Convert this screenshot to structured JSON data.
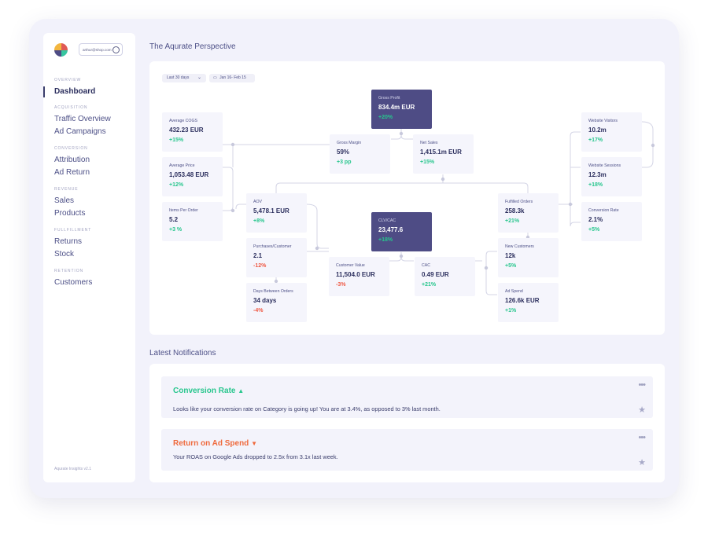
{
  "sidebar": {
    "user_email": "arthur@shop.com",
    "sections": [
      {
        "label": "Overview",
        "items": [
          "Dashboard"
        ]
      },
      {
        "label": "Acquisition",
        "items": [
          "Traffic Overview",
          "Ad Campaigns"
        ]
      },
      {
        "label": "Conversion",
        "items": [
          "Attribution",
          "Ad Return"
        ]
      },
      {
        "label": "Revenue",
        "items": [
          "Sales",
          "Products"
        ]
      },
      {
        "label": "Fullfillment",
        "items": [
          "Returns",
          "Stock"
        ]
      },
      {
        "label": "Retention",
        "items": [
          "Customers"
        ]
      }
    ],
    "version": "Aqurate Insights v2.1"
  },
  "main": {
    "title": "The Aqurate Perspective",
    "period_select": "Last 30 days",
    "date_range": "Jan 16- Feb 15"
  },
  "kpis": {
    "gross_profit": {
      "label": "Gross Profit",
      "value": "834.4m EUR",
      "change": "+20%"
    },
    "gross_margin": {
      "label": "Gross Margin",
      "value": "59%",
      "change": "+3 pp"
    },
    "net_sales": {
      "label": "Net Sales",
      "value": "1,415.1m EUR",
      "change": "+15%"
    },
    "avg_cogs": {
      "label": "Average COGS",
      "value": "432.23 EUR",
      "change": "+15%"
    },
    "avg_price": {
      "label": "Average Price",
      "value": "1,053.48 EUR",
      "change": "+12%"
    },
    "items_per_order": {
      "label": "Items Per Order",
      "value": "5.2",
      "change": "+3 %"
    },
    "aov": {
      "label": "AOV",
      "value": "5,478.1 EUR",
      "change": "+8%"
    },
    "purchases_customer": {
      "label": "Purchases/Customer",
      "value": "2.1",
      "change": "-12%"
    },
    "days_between": {
      "label": "Days Between Orders",
      "value": "34 days",
      "change": "-4%"
    },
    "clv_cac": {
      "label": "CLV/CAC",
      "value": "23,477.6",
      "change": "+18%"
    },
    "customer_value": {
      "label": "Customer Value",
      "value": "11,504.0 EUR",
      "change": "-3%"
    },
    "cac": {
      "label": "CAC",
      "value": "0.49 EUR",
      "change": "+21%"
    },
    "fulfilled_orders": {
      "label": "Fulfilled Orders",
      "value": "258.3k",
      "change": "+21%"
    },
    "new_customers": {
      "label": "New Customers",
      "value": "12k",
      "change": "+5%"
    },
    "ad_spend": {
      "label": "Ad Spend",
      "value": "126.6k EUR",
      "change": "+1%"
    },
    "website_visitors": {
      "label": "Website Visitors",
      "value": "10.2m",
      "change": "+17%"
    },
    "website_sessions": {
      "label": "Website Sessions",
      "value": "12.3m",
      "change": "+18%"
    },
    "conversion_rate": {
      "label": "Conversion Rate",
      "value": "2.1%",
      "change": "+5%"
    }
  },
  "notifications": {
    "title": "Latest Notifications",
    "items": [
      {
        "title": "Conversion Rate",
        "direction": "up",
        "color": "#27c68d",
        "body": "Looks like your conversion rate on Category is going up! You are at 3.4%, as opposed to 3% last month."
      },
      {
        "title": "Return on Ad Spend",
        "direction": "down",
        "color": "#ef6a3d",
        "body": "Your ROAS on Google Ads dropped to 2.5x from 3.1x last week."
      }
    ]
  },
  "colors": {
    "accent_dark": "#4e4c85",
    "positive": "#27c68d",
    "negative": "#ef5a45"
  }
}
